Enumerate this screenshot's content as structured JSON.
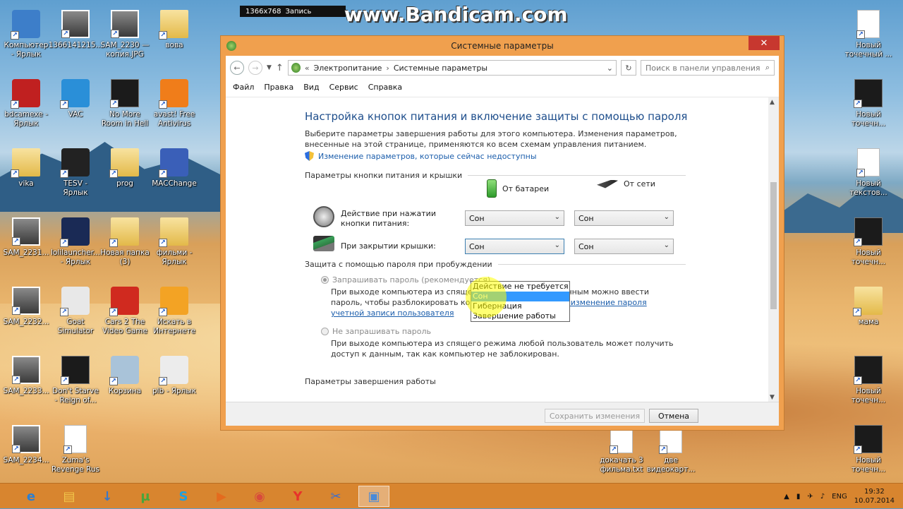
{
  "recorder": {
    "watermark": "www.Bandicam.com",
    "resolution": "1366x768",
    "status": "Запись"
  },
  "desktop_left": [
    {
      "label": "Компьютер\n- Ярлык",
      "kind": "pc",
      "icon": "computer-icon"
    },
    {
      "label": "1366141215...",
      "kind": "photo",
      "icon": "photo-icon"
    },
    {
      "label": "SAM_2230 —\nкопия.JPG",
      "kind": "photo",
      "icon": "photo-icon"
    },
    {
      "label": "вова",
      "kind": "folder",
      "icon": "folder-icon"
    },
    {
      "label": "bdcamexe -\nЯрлык",
      "kind": "rec",
      "icon": "bandicam-icon"
    },
    {
      "label": "VAC",
      "kind": "vac",
      "icon": "shield-icon"
    },
    {
      "label": "No More\nRoom in Hell",
      "kind": "dark",
      "icon": "game-icon"
    },
    {
      "label": "avast! Free\nAntivirus",
      "kind": "avast",
      "icon": "avast-icon"
    },
    {
      "label": "vika",
      "kind": "folder",
      "icon": "folder-icon"
    },
    {
      "label": "TESV -\nЯрлык",
      "kind": "tes",
      "icon": "skyrim-icon"
    },
    {
      "label": "prog",
      "kind": "folder",
      "icon": "folder-icon"
    },
    {
      "label": "MACChange",
      "kind": "mac",
      "icon": "network-icon"
    },
    {
      "label": "SAM_2231...",
      "kind": "photo",
      "icon": "photo-icon"
    },
    {
      "label": "lolilauncher...\n- Ярлык",
      "kind": "lol",
      "icon": "launcher-icon"
    },
    {
      "label": "Новая папка\n(3)",
      "kind": "folder",
      "icon": "folder-icon"
    },
    {
      "label": "фильми -\nЯрлык",
      "kind": "folder",
      "icon": "folder-icon"
    },
    {
      "label": "SAM_2232...",
      "kind": "photo",
      "icon": "photo-icon"
    },
    {
      "label": "Goat\nSimulator",
      "kind": "goat",
      "icon": "goat-icon"
    },
    {
      "label": "Cars 2 The\nVideo Game",
      "kind": "cars",
      "icon": "car-icon"
    },
    {
      "label": "Искать в\nИнтернете",
      "kind": "search",
      "icon": "search-icon"
    },
    {
      "label": "SAM_2233...",
      "kind": "photo",
      "icon": "photo-icon"
    },
    {
      "label": "Don't Starve\n- Reign of...",
      "kind": "dark",
      "icon": "game-icon"
    },
    {
      "label": "Корзина",
      "kind": "bin",
      "icon": "recycle-bin-icon"
    },
    {
      "label": "plb - Ярлык",
      "kind": "plb",
      "icon": "app-icon"
    },
    {
      "label": "SAM_2234...",
      "kind": "photo",
      "icon": "photo-icon"
    },
    {
      "label": "Zuma's\nRevenge Rus",
      "kind": "doc",
      "icon": "document-icon"
    }
  ],
  "desktop_right": [
    {
      "label": "Новый\nточечный ...",
      "kind": "doc",
      "icon": "document-icon"
    },
    {
      "label": "Новый\nточечн...",
      "kind": "dark",
      "icon": "image-icon"
    },
    {
      "label": "Новый\nтекстов...",
      "kind": "doc",
      "icon": "document-icon"
    },
    {
      "label": "Новый\nточечн...",
      "kind": "dark",
      "icon": "image-icon"
    },
    {
      "label": "мама",
      "kind": "folder",
      "icon": "folder-icon"
    },
    {
      "label": "Новый\nточечн...",
      "kind": "dark",
      "icon": "image-icon"
    },
    {
      "label": "Новый\nточечн...",
      "kind": "dark",
      "icon": "image-icon"
    }
  ],
  "desktop_bottom": [
    {
      "label": "докачать 3\nфильма.txt",
      "kind": "doc",
      "icon": "document-icon"
    },
    {
      "label": "две\nвидеокарт...",
      "kind": "doc",
      "icon": "document-icon"
    }
  ],
  "window": {
    "title": "Системные параметры",
    "close_glyph": "✕",
    "address": {
      "crumb_prefix": "«",
      "crumb1": "Электропитание",
      "crumb_sep": "›",
      "crumb2": "Системные параметры",
      "search_placeholder": "Поиск в панели управления"
    },
    "menu": [
      "Файл",
      "Правка",
      "Вид",
      "Сервис",
      "Справка"
    ],
    "heading": "Настройка кнопок питания и включение защиты с помощью пароля",
    "description": "Выберите параметры завершения работы для этого компьютера. Изменения параметров, внесенные на этой странице, применяются ко всем схемам управления питанием.",
    "unavailable_link": "Изменение параметров, которые сейчас недоступны",
    "section_buttons": "Параметры кнопки питания и крышки",
    "col_battery": "От батареи",
    "col_ac": "От сети",
    "row_power_label": "Действие при нажатии кнопки питания:",
    "row_lid_label": "При закрытии крышки:",
    "power_battery_value": "Сон",
    "power_ac_value": "Сон",
    "lid_battery_value": "Сон",
    "lid_ac_value": "Сон",
    "dropdown_options": [
      "Действие не требуется",
      "Сон",
      "Гибернация",
      "Завершение работы"
    ],
    "dropdown_selected_index": 1,
    "section_password": "Защита с помощью пароля при пробуждении",
    "radio_require": "Запрашивать пароль (рекомендуется)",
    "radio_require_desc": "При выходе компьютера из спящего режима доступ к данным можно ввести пароль, чтобы разблокировать компьютер.",
    "radio_require_link": "Создание или изменение пароля учетной записи пользователя",
    "radio_norequire": "Не запрашивать пароль",
    "radio_norequire_desc": "При выходе компьютера из спящего режима любой пользователь может получить доступ к данным, так как компьютер не заблокирован.",
    "section_shutdown": "Параметры завершения работы",
    "save_button": "Сохранить изменения",
    "cancel_button": "Отмена"
  },
  "taskbar": {
    "language": "ENG",
    "time": "19:32",
    "date": "10.07.2014",
    "apps": [
      {
        "glyph": "e",
        "icon": "internet-explorer-icon",
        "color": "#2a7fd4"
      },
      {
        "glyph": "▤",
        "icon": "file-explorer-icon",
        "color": "#f0c64a"
      },
      {
        "glyph": "↓",
        "icon": "download-icon",
        "color": "#3a78c8"
      },
      {
        "glyph": "µ",
        "icon": "utorrent-icon",
        "color": "#49a53b"
      },
      {
        "glyph": "S",
        "icon": "skype-icon",
        "color": "#1da1e0"
      },
      {
        "glyph": "▶",
        "icon": "media-player-icon",
        "color": "#e46b1e"
      },
      {
        "glyph": "◉",
        "icon": "chrome-icon",
        "color": "#d84b3c"
      },
      {
        "glyph": "Y",
        "icon": "yandex-browser-icon",
        "color": "#e8332a"
      },
      {
        "glyph": "✂",
        "icon": "video-editor-icon",
        "color": "#3a6fd0"
      },
      {
        "glyph": "▣",
        "icon": "control-panel-icon",
        "color": "#4a8ad8"
      }
    ]
  }
}
